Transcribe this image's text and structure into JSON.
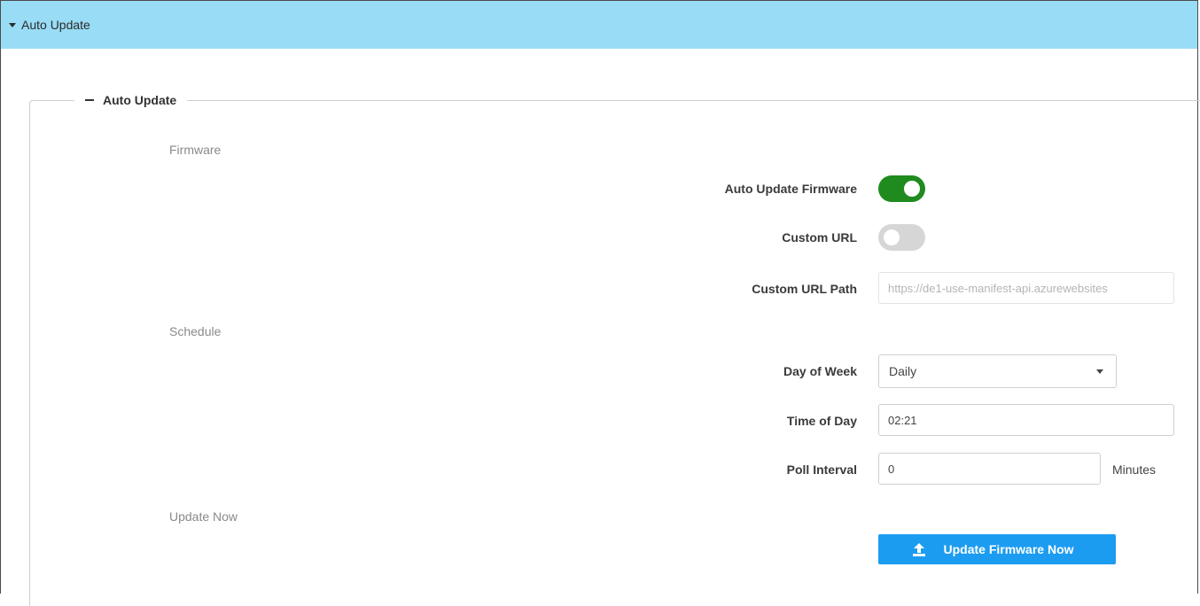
{
  "header": {
    "title": "Auto Update"
  },
  "fieldset": {
    "legend": "Auto Update"
  },
  "sections": {
    "firmware": "Firmware",
    "schedule": "Schedule",
    "update_now": "Update Now"
  },
  "fields": {
    "auto_update_firmware": {
      "label": "Auto Update Firmware",
      "enabled": true
    },
    "custom_url": {
      "label": "Custom URL",
      "enabled": false
    },
    "custom_url_path": {
      "label": "Custom URL Path",
      "value": "https://de1-use-manifest-api.azurewebsites"
    },
    "day_of_week": {
      "label": "Day of Week",
      "value": "Daily"
    },
    "time_of_day": {
      "label": "Time of Day",
      "value": "02:21"
    },
    "poll_interval": {
      "label": "Poll Interval",
      "value": "0",
      "suffix": "Minutes"
    }
  },
  "actions": {
    "update_firmware_now": "Update Firmware Now"
  },
  "colors": {
    "header_bg": "#99dcf5",
    "toggle_on": "#1f8b1f",
    "toggle_off": "#d6d6d6",
    "primary_button": "#1c9cf0"
  },
  "icons": {
    "header_caret": "caret-down-icon",
    "collapse": "minus-icon",
    "select_caret": "caret-down-icon",
    "button_icon": "upload-icon"
  }
}
